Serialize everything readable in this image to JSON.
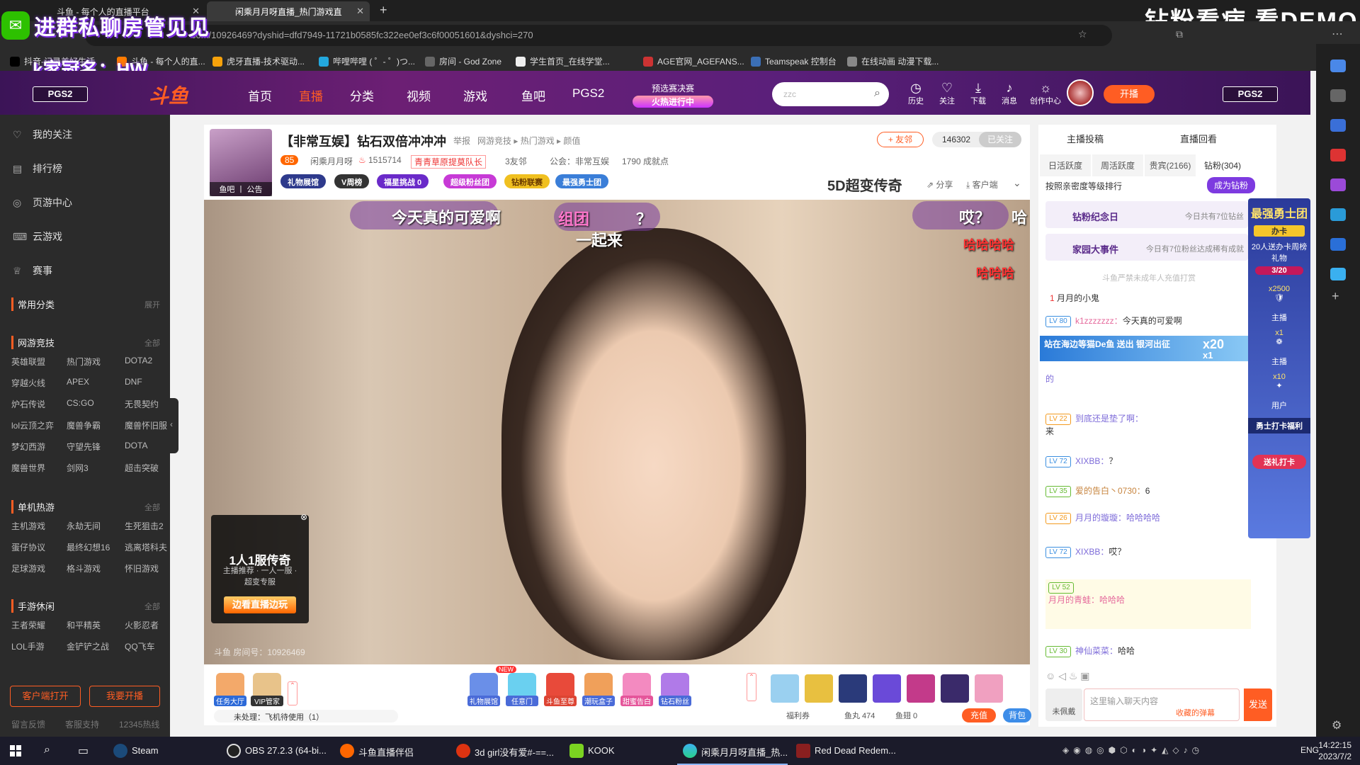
{
  "browser": {
    "tabs": [
      {
        "label": "斗鱼 - 每个人的直播平台"
      },
      {
        "label": "闲乘月月呀直播_热门游戏直"
      }
    ],
    "new_tab": "+",
    "url": "com/10926469?dyshid=dfd7949-11721b0585fc322ee0ef3c6f00051601&dyshci=270",
    "bookmarks": [
      "抖音-记录美好生活",
      "斗鱼 - 每个人的直...",
      "虎牙直播-技术驱动...",
      "哔哩哔哩 ( ゜- ゜)つ...",
      "房间 - God Zone",
      "学生首页_在线学堂...",
      "AGE官网_AGEFANS...",
      "Teamspeak 控制台",
      "在线动画 动漫下载..."
    ]
  },
  "overlays": {
    "top_left": "进群私聊房管见见",
    "name_tag": "k家冠名：HW",
    "top_right": "钻粉看病 看DEMO"
  },
  "header": {
    "pgs_left": "PGS2",
    "pgs_right": "PGS2",
    "logo": "斗鱼",
    "nav": [
      "首页",
      "直播",
      "分类",
      "视频",
      "游戏",
      "鱼吧",
      "PGS2"
    ],
    "preq_top": "预选赛决赛",
    "preq_bottom": "火热进行中",
    "search_placeholder": "zzc",
    "icons": [
      "历史",
      "关注",
      "下载",
      "消息",
      "创作中心"
    ],
    "open_live": "开播"
  },
  "sidebar": {
    "items": [
      "我的关注",
      "排行榜",
      "页游中心",
      "云游戏",
      "赛事"
    ],
    "common_label": "常用分类",
    "common_action": "展开",
    "sections": [
      {
        "title": "网游竞技",
        "more": "全部",
        "games": [
          "英雄联盟",
          "热门游戏",
          "DOTA2",
          "穿越火线",
          "APEX",
          "DNF",
          "炉石传说",
          "CS:GO",
          "无畏契约",
          "lol云顶之弈",
          "魔兽争霸",
          "魔兽怀旧服",
          "梦幻西游",
          "守望先锋",
          "DOTA",
          "魔兽世界",
          "剑网3",
          "超击突破"
        ]
      },
      {
        "title": "单机热游",
        "more": "全部",
        "games": [
          "主机游戏",
          "永劫无间",
          "生死狙击2",
          "蛋仔协议",
          "最终幻想16",
          "逃离塔科夫",
          "足球游戏",
          "格斗游戏",
          "怀旧游戏"
        ]
      },
      {
        "title": "手游休闲",
        "more": "全部",
        "games": [
          "王者荣耀",
          "和平精英",
          "火影忍者",
          "LOL手游",
          "金铲铲之战",
          "QQ飞车"
        ]
      }
    ],
    "btn_client": "客户端打开",
    "btn_live": "我要开播",
    "footer": [
      "留言反馈",
      "客服支持",
      "12345热线"
    ]
  },
  "room": {
    "pic_caption": "鱼吧 丨 公告",
    "title": "【非常互娱】钻石双倍冲冲冲",
    "report": "举报",
    "category": "网游竞技 ▸ 热门游戏 ▸ 颜值",
    "level": "85",
    "streamer": "闲乘月月呀",
    "hot": "1515714",
    "badge": "青青草原提莫队长",
    "friends": "3友邻",
    "guild": "公会：非常互娱",
    "achievement": "1790 成就点",
    "pills": [
      "礼物展馆",
      "V周榜",
      "福星挑战 0",
      "超级粉丝团",
      "钻粉联赛",
      "最强勇士团"
    ],
    "follow": "+ 友邻",
    "follow_count": "146302",
    "followed": "已关注",
    "super5d": "5D超变传奇",
    "share": "分享",
    "client": "客户端"
  },
  "video": {
    "danmaku": [
      "今天真的可爱啊",
      "组团",
      "？",
      "一起来",
      "哎？",
      "哈哈哈哈",
      "哈哈哈",
      "哈"
    ],
    "promo_title": "1人1服传奇",
    "promo_sub": "主播推荐 · 一人一服 · 超变专服",
    "promo_btn": "边看直播边玩",
    "room_no": "斗鱼 房间号：10926469"
  },
  "giftbar": {
    "left_gifts": [
      "任务大厅",
      "VIP管家"
    ],
    "gifts": [
      "礼物展馆",
      "任意门",
      "斗鱼至尊",
      "潮玩盒子",
      "甜蜜告白",
      "钻石粉丝"
    ],
    "new_badge": "NEW",
    "pending": "未处理：飞机待使用（1）",
    "welfare": "福利券",
    "fish_pill": "鱼丸 474",
    "fish_ball": "鱼翅 0",
    "recharge": "充值",
    "bag": "背包"
  },
  "rpanel": {
    "top_tabs": [
      "主播投稿",
      "直播回看"
    ],
    "tabs": [
      "日活跃度",
      "周活跃度",
      "贵宾(2166)",
      "钻粉(304)"
    ],
    "sort_label": "按照亲密度等级排行",
    "become_fan": "成为钻粉",
    "rows": [
      {
        "name": "钻粉纪念日",
        "sub": "今日共有7位钻丝"
      },
      {
        "name": "家园大事件",
        "sub": "今日有7位粉丝达成稀有成就"
      }
    ],
    "notice": "斗鱼严禁未成年人充值打赏",
    "top_user": "月月的小鬼",
    "chats": [
      {
        "lv": "LV 80",
        "user": "k1zzzzzzz：",
        "text": "今天真的可爱啊"
      },
      {
        "lv": "LV 22",
        "user": "到底还是垫了啊：",
        "text": "来"
      },
      {
        "lv": "LV 72",
        "user": "XIXBB：",
        "text": "？"
      },
      {
        "lv": "LV 35",
        "user": "爱的告白丶0730：",
        "text": "6"
      },
      {
        "lv": "LV 26",
        "user": "月月的璇璇：",
        "text": "哈哈哈哈"
      },
      {
        "lv": "LV 72",
        "user": "XIXBB：",
        "text": "哎？"
      },
      {
        "lv": "LV 52",
        "user": "月月的青蛙：",
        "text": "哈哈哈"
      },
      {
        "lv": "LV 30",
        "user": "神仙菜菜：",
        "text": "哈哈"
      }
    ],
    "gift_banner": "站在海边等猫De鱼 送出 银河出征",
    "gift_x20": "x20",
    "gift_x1": "x1",
    "de": "的",
    "fan_tag": "未佩戴",
    "input_placeholder": "这里输入聊天内容",
    "bullet": "收藏的弹幕",
    "send": "发送"
  },
  "floatcol": {
    "title": "最强勇士团",
    "card": "办卡",
    "desc": "20人送办卡周榜礼物",
    "progress": "3/20",
    "x2500": "x2500",
    "x1": "x1",
    "x10": "x10",
    "streamer1": "主播",
    "streamer2": "主播",
    "user": "用户",
    "welfare": "勇士打卡福利",
    "btn": "送礼打卡"
  },
  "taskbar": {
    "apps": [
      "Steam",
      "OBS 27.2.3 (64-bi...",
      "斗鱼直播伴侣",
      "3d girl没有爱#-==...",
      "KOOK",
      "闲乘月月呀直播_热...",
      "Red Dead Redem..."
    ],
    "lang": "ENG",
    "time": "14:22:15",
    "date": "2023/7/2"
  }
}
